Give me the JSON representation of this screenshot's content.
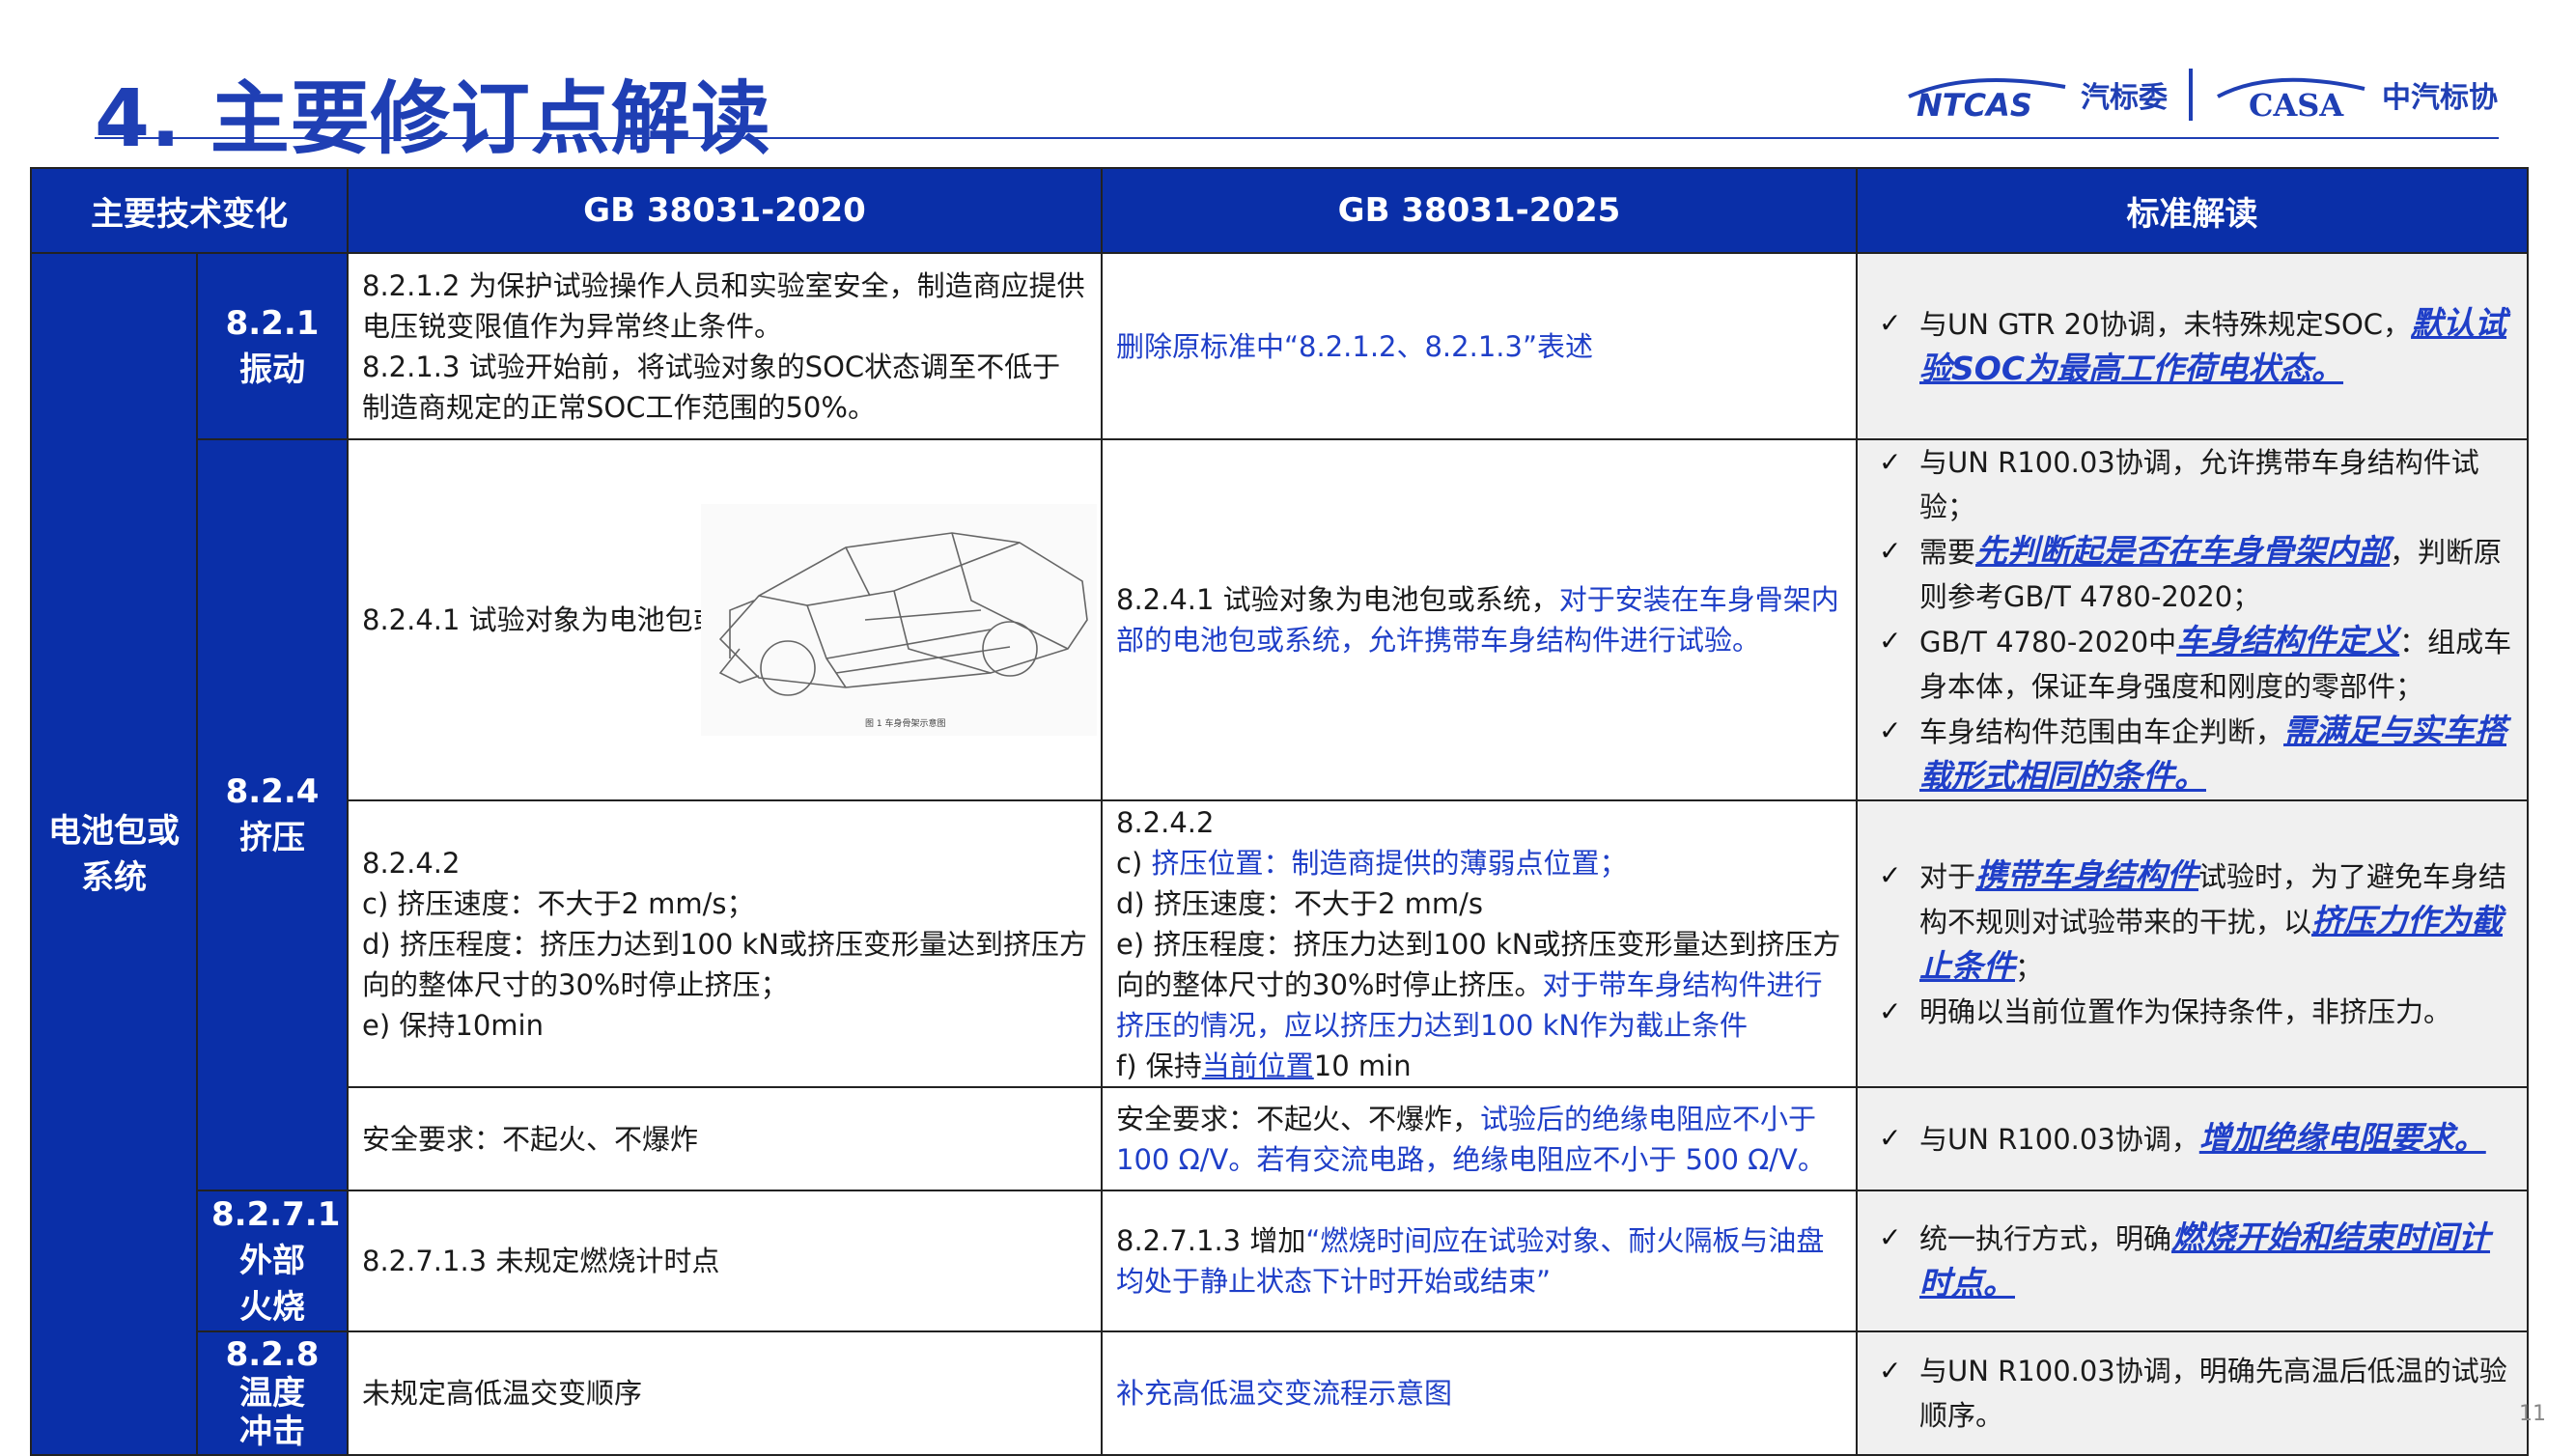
{
  "title": "4. 主要修订点解读",
  "logos": {
    "ntcas_text": "NTCAS",
    "ntcas_cn": "汽标委",
    "casa_text": "CASA",
    "casa_cn": "中汽标协"
  },
  "headers": [
    "主要技术变化",
    "GB 38031-2020",
    "GB 38031-2025",
    "标准解读"
  ],
  "category": "电池包或系统",
  "rows": {
    "r1": {
      "section": "8.2.1\n振动",
      "old": [
        "8.2.1.2 为保护试验操作人员和实验室安全，制造商应提供电压锐变限值作为异常终止条件。",
        "8.2.1.3 试验开始前，将试验对象的SOC状态调至不低于制造商规定的正常SOC工作范围的50%。"
      ],
      "new": "删除原标准中“8.2.1.2、8.2.1.3”表述",
      "interp": [
        {
          "pre": "与UN GTR 20协调，未特殊规定SOC，",
          "em": "默认试验SOC为最高工作荷电状态。"
        }
      ]
    },
    "r2": {
      "section": "8.2.4\n挤压",
      "old": "8.2.4.1 试验对象为电池包或系统。",
      "figure_caption": "图 1  车身骨架示意图",
      "new_pre": "8.2.4.1 试验对象为电池包或系统，",
      "new_blue": "对于安装在车身骨架内部的电池包或系统，允许携带车身结构件进行试验。",
      "interp": [
        {
          "pre": "与UN R100.03协调，允许携带车身结构件试验；"
        },
        {
          "pre": "需要",
          "em": "先判断起是否在车身骨架内部",
          "post": "，判断原则参考GB/T 4780-2020；"
        },
        {
          "pre": "GB/T 4780-2020中",
          "em": "车身结构件定义",
          "post": "：组成车身本体，保证车身强度和刚度的零部件；"
        },
        {
          "pre": "车身结构件范围由车企判断，",
          "em": "需满足与实车搭载形式相同的条件。"
        }
      ]
    },
    "r3": {
      "old": [
        "8.2.4.2",
        "c) 挤压速度：不大于2 mm/s；",
        "d) 挤压程度：挤压力达到100 kN或挤压变形量达到挤压方向的整体尺寸的30%时停止挤压；",
        "e) 保持10min"
      ],
      "new_l1": "8.2.4.2",
      "new_l2_pre": "c) ",
      "new_l2_blue": "挤压位置：制造商提供的薄弱点位置；",
      "new_l3": "d) 挤压速度：不大于2 mm/s",
      "new_l4_pre": "e) 挤压程度：挤压力达到100 kN或挤压变形量达到挤压方向的整体尺寸的30%时停止挤压。",
      "new_l4_blue": "对于带车身结构件进行挤压的情况，应以挤压力达到100 kN作为截止条件",
      "new_l5_pre": "f) 保持",
      "new_l5_blue": "当前位置",
      "new_l5_post": "10 min",
      "interp": [
        {
          "pre": "对于",
          "em": "携带车身结构件",
          "mid": "试验时，为了避免车身结构不规则对试验带来的干扰，以",
          "em2": "挤压力作为截止条件",
          "post": "；"
        },
        {
          "pre": "明确以当前位置作为保持条件，非挤压力。"
        }
      ]
    },
    "r4": {
      "old": "安全要求：不起火、不爆炸",
      "new_pre": "安全要求：不起火、不爆炸，",
      "new_blue": "试验后的绝缘电阻应不小于100 Ω/V。若有交流电路，绝缘电阻应不小于 500 Ω/V。",
      "interp": [
        {
          "pre": "与UN R100.03协调，",
          "em": "增加绝缘电阻要求。"
        }
      ]
    },
    "r5": {
      "section": "8.2.7.1\n外部\n火烧",
      "old": "8.2.7.1.3 未规定燃烧计时点",
      "new_pre": "8.2.7.1.3 增加",
      "new_blue": "“燃烧时间应在试验对象、耐火隔板与油盘均处于静止状态下计时开始或结束”",
      "interp": [
        {
          "pre": "统一执行方式，明确",
          "em": "燃烧开始和结束时间计时点。"
        }
      ]
    },
    "r6": {
      "section": "8.2.8\n温度\n冲击",
      "old": "未规定高低温交变顺序",
      "new_blue": "补充高低温交变流程示意图",
      "interp": [
        {
          "pre": "与UN R100.03协调，明确先高温后低温的试验顺序。"
        }
      ]
    }
  },
  "page_number": "11",
  "colors": {
    "header_bg": "#0a2fa8",
    "title": "#1f3fb4",
    "highlight_text": "#1f3fc8",
    "interp_bg": "#f0f0f0"
  }
}
